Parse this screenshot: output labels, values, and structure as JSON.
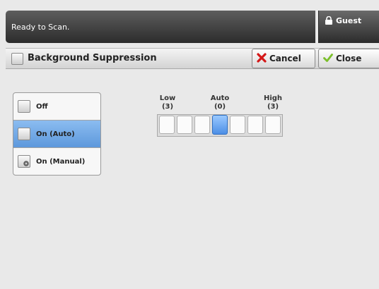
{
  "status_bar": {
    "text": "Ready to Scan.",
    "user_label": "Guest",
    "user_icon": "padlock-icon"
  },
  "dialog": {
    "title": "Background Suppression",
    "buttons": {
      "cancel_label": "Cancel",
      "cancel_icon": "red-x-icon",
      "close_label": "Close",
      "close_icon": "green-check-icon"
    }
  },
  "suppression_options": [
    {
      "label": "Off",
      "selected": false
    },
    {
      "label": "On (Auto)",
      "selected": true
    },
    {
      "label": "On (Manual)",
      "selected": false
    }
  ],
  "level_slider": {
    "low_label": "Low",
    "low_value": "(3)",
    "auto_label": "Auto",
    "auto_value": "(0)",
    "high_label": "High",
    "high_value": "(3)",
    "segment_count": 7,
    "selected_segment": 4
  },
  "colors": {
    "accent": "#5d98dc",
    "status_bar": "#3a3a3a"
  }
}
